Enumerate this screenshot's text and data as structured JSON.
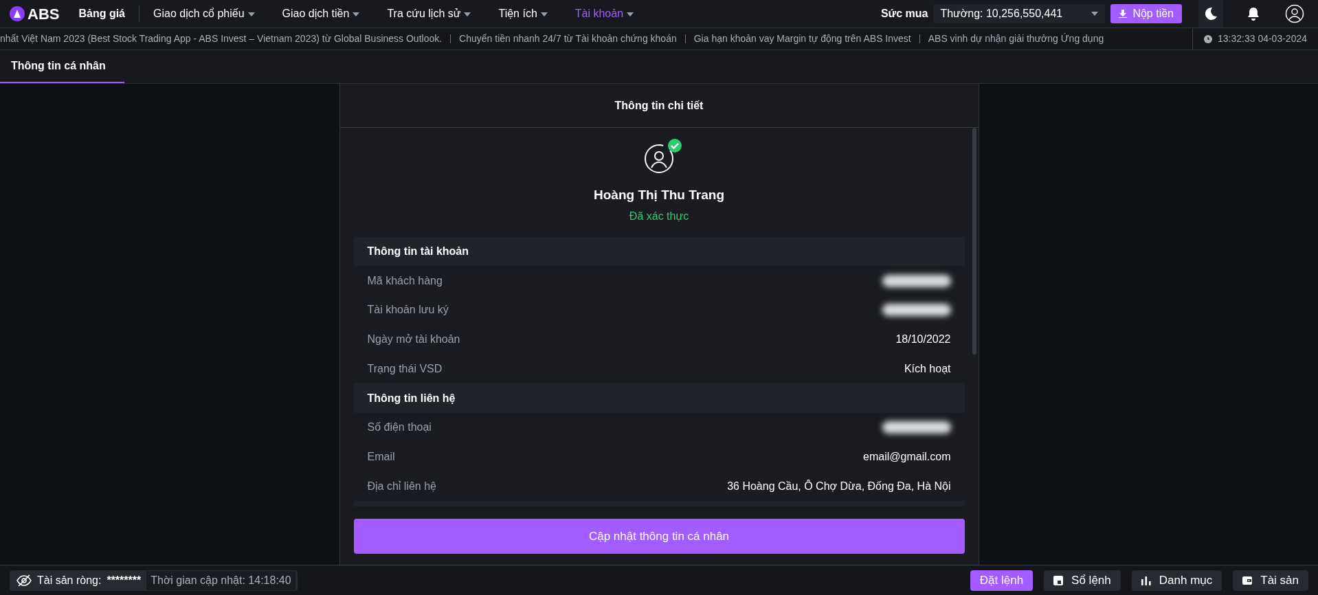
{
  "brand": {
    "name": "ABS"
  },
  "nav": [
    {
      "label": "Bảng giá",
      "selected": false,
      "dropdown": false
    },
    {
      "label": "Giao dịch cổ phiếu",
      "selected": false,
      "dropdown": true
    },
    {
      "label": "Giao dịch tiền",
      "selected": false,
      "dropdown": true
    },
    {
      "label": "Tra cứu lịch sử",
      "selected": false,
      "dropdown": true
    },
    {
      "label": "Tiện ích",
      "selected": false,
      "dropdown": true
    },
    {
      "label": "Tài khoản",
      "selected": true,
      "dropdown": true
    }
  ],
  "buying_power": {
    "label": "Sức mua",
    "value": "Thường: 10,256,550,441"
  },
  "deposit_button": "Nộp tiền",
  "ticker": [
    "nhất Việt Nam 2023 (Best Stock Trading App - ABS Invest – Vietnam 2023) từ Global Business Outlook.",
    "Chuyển tiền nhanh 24/7 từ Tài khoản chứng khoán",
    "Gia hạn khoản vay Margin tự động trên ABS Invest",
    "ABS vinh dự nhận giải thưởng Ứng dụng"
  ],
  "clock": "13:32:33 04-03-2024",
  "tabs": [
    {
      "label": "Thông tin cá nhân",
      "selected": true
    }
  ],
  "panel": {
    "title": "Thông tin chi tiết",
    "user_name": "Hoàng Thị Thu Trang",
    "verified": true,
    "status": "Đã xác thực",
    "sections": [
      {
        "title": "Thông tin tài khoản",
        "rows": [
          {
            "label": "Mã khách hàng",
            "blurred": true
          },
          {
            "label": "Tài khoản lưu ký",
            "blurred": true
          },
          {
            "label": "Ngày mở tài khoản",
            "value": "18/10/2022",
            "blurred": false
          },
          {
            "label": "Trạng thái VSD",
            "value": "Kích hoạt",
            "blurred": false
          }
        ]
      },
      {
        "title": "Thông tin liên hệ",
        "rows": [
          {
            "label": "Số điện thoại",
            "blurred": true
          },
          {
            "label": "Email",
            "value": "email@gmail.com",
            "blurred": false
          },
          {
            "label": "Địa chỉ liên hệ",
            "value": "36 Hoàng Cầu, Ô Chợ Dừa, Đống Đa, Hà Nội",
            "blurred": false
          }
        ]
      }
    ],
    "update_button": "Cập nhật thông tin cá nhân"
  },
  "footer": {
    "net_assets_label": "Tài sản ròng:",
    "net_assets_value": "********",
    "hidden": true,
    "update_time": "Thời gian cập nhật: 14:18:40",
    "buttons": [
      {
        "label": "Đặt lệnh",
        "kind": "primary"
      },
      {
        "label": "Sổ lệnh",
        "kind": "book"
      },
      {
        "label": "Danh mục",
        "kind": "chart"
      },
      {
        "label": "Tài sản",
        "kind": "wallet"
      }
    ]
  }
}
